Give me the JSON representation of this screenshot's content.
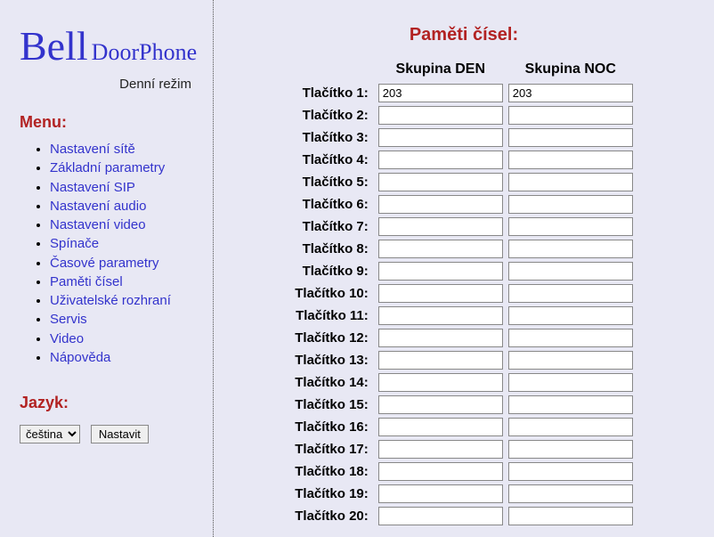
{
  "logo": {
    "part1": "Bell",
    "part2": "DoorPhone"
  },
  "mode_line": "Denní režim",
  "menu_title": "Menu:",
  "menu_items": [
    "Nastavení sítě",
    "Základní parametry",
    "Nastavení SIP",
    "Nastavení audio",
    "Nastavení video",
    "Spínače",
    "Časové parametry",
    "Paměti čísel",
    "Uživatelské rozhraní",
    "Servis",
    "Video",
    "Nápověda"
  ],
  "lang_title": "Jazyk:",
  "lang_selected": "čeština",
  "lang_button": "Nastavit",
  "page_title": "Paměti čísel:",
  "col_day": "Skupina DEN",
  "col_night": "Skupina NOC",
  "row_label_prefix": "Tlačítko ",
  "rows": [
    {
      "n": 1,
      "day": "203",
      "night": "203"
    },
    {
      "n": 2,
      "day": "",
      "night": ""
    },
    {
      "n": 3,
      "day": "",
      "night": ""
    },
    {
      "n": 4,
      "day": "",
      "night": ""
    },
    {
      "n": 5,
      "day": "",
      "night": ""
    },
    {
      "n": 6,
      "day": "",
      "night": ""
    },
    {
      "n": 7,
      "day": "",
      "night": ""
    },
    {
      "n": 8,
      "day": "",
      "night": ""
    },
    {
      "n": 9,
      "day": "",
      "night": ""
    },
    {
      "n": 10,
      "day": "",
      "night": ""
    },
    {
      "n": 11,
      "day": "",
      "night": ""
    },
    {
      "n": 12,
      "day": "",
      "night": ""
    },
    {
      "n": 13,
      "day": "",
      "night": ""
    },
    {
      "n": 14,
      "day": "",
      "night": ""
    },
    {
      "n": 15,
      "day": "",
      "night": ""
    },
    {
      "n": 16,
      "day": "",
      "night": ""
    },
    {
      "n": 17,
      "day": "",
      "night": ""
    },
    {
      "n": 18,
      "day": "",
      "night": ""
    },
    {
      "n": 19,
      "day": "",
      "night": ""
    },
    {
      "n": 20,
      "day": "",
      "night": ""
    }
  ]
}
